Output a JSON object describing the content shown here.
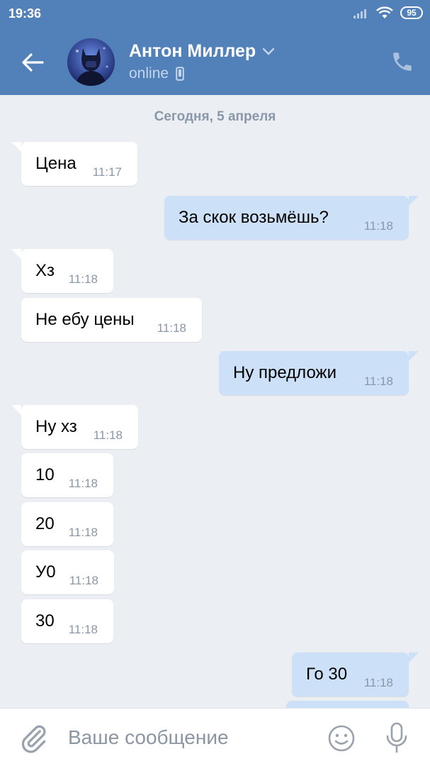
{
  "status_bar": {
    "time": "19:36",
    "battery": "95"
  },
  "header": {
    "contact_name": "Антон Миллер",
    "status": "online"
  },
  "chat": {
    "date_separator": "Сегодня, 5 апреля",
    "messages": [
      {
        "direction": "in",
        "text": "Цена",
        "time": "11:17"
      },
      {
        "direction": "out",
        "text": "За скок возьмёшь?",
        "time": "11:18"
      },
      {
        "direction": "in",
        "text": "Хз",
        "time": "11:18"
      },
      {
        "direction": "in",
        "text": "Не ебу цены",
        "time": "11:18"
      },
      {
        "direction": "out",
        "text": "Ну предложи",
        "time": "11:18"
      },
      {
        "direction": "in",
        "text": "Ну хз",
        "time": "11:18"
      },
      {
        "direction": "in",
        "text": "10",
        "time": "11:18"
      },
      {
        "direction": "in",
        "text": "20",
        "time": "11:18"
      },
      {
        "direction": "in",
        "text": "У0",
        "time": "11:18"
      },
      {
        "direction": "in",
        "text": "30",
        "time": "11:18"
      },
      {
        "direction": "out",
        "text": "Го 30",
        "time": "11:18"
      }
    ]
  },
  "input_bar": {
    "placeholder": "Ваше сообщение"
  },
  "colors": {
    "header": "#5181b8",
    "background": "#ebeef3",
    "outgoing_bubble": "#cce0f7",
    "incoming_bubble": "#ffffff"
  },
  "icons": [
    "back-arrow-icon",
    "chevron-down-icon",
    "phone-icon",
    "mobile-device-icon",
    "paperclip-icon",
    "smiley-icon",
    "microphone-icon",
    "signal-icon",
    "wifi-icon",
    "battery-icon"
  ]
}
